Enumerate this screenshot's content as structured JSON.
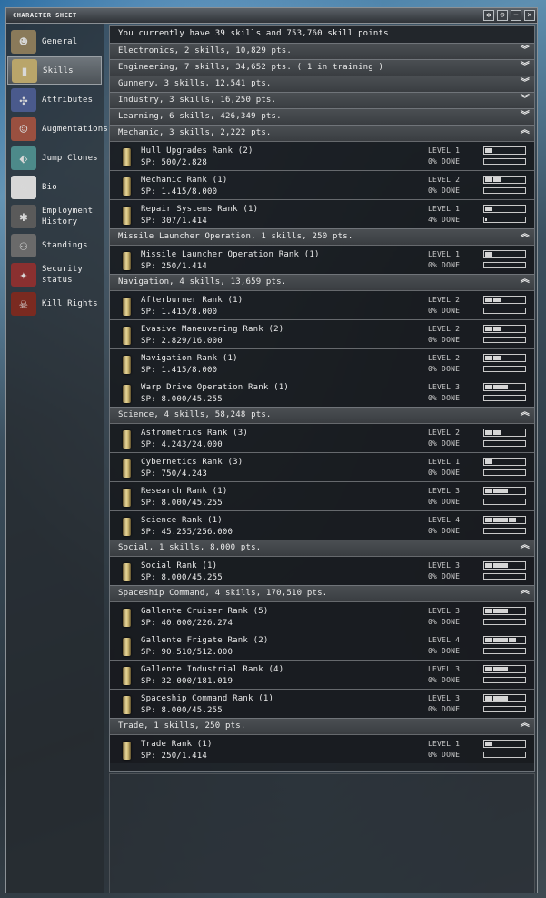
{
  "window": {
    "title": "CHARACTER SHEET"
  },
  "sidebar": [
    {
      "label": "General",
      "icon": "portrait-icon"
    },
    {
      "label": "Skills",
      "icon": "skillbook-icon"
    },
    {
      "label": "Attributes",
      "icon": "dna-icon"
    },
    {
      "label": "Augmentations",
      "icon": "augmentation-icon"
    },
    {
      "label": "Jump Clones",
      "icon": "jump-clone-icon"
    },
    {
      "label": "Bio",
      "icon": "bio-icon"
    },
    {
      "label": "Employment History",
      "icon": "employment-icon"
    },
    {
      "label": "Standings",
      "icon": "standings-icon"
    },
    {
      "label": "Security status",
      "icon": "security-icon"
    },
    {
      "label": "Kill Rights",
      "icon": "kill-rights-icon"
    }
  ],
  "summary": "You currently have 39 skills and 753,760 skill points",
  "groups": [
    {
      "label": "Electronics, 2 skills, 10,829 pts.",
      "expanded": false,
      "skills": []
    },
    {
      "label": "Engineering, 7 skills, 34,652 pts. ( 1 in training )",
      "expanded": false,
      "skills": []
    },
    {
      "label": "Gunnery, 3 skills, 12,541 pts.",
      "expanded": false,
      "skills": []
    },
    {
      "label": "Industry, 3 skills, 16,250 pts.",
      "expanded": false,
      "skills": []
    },
    {
      "label": "Learning, 6 skills, 426,349 pts.",
      "expanded": false,
      "skills": []
    },
    {
      "label": "Mechanic, 3 skills, 2,222 pts.",
      "expanded": true,
      "skills": [
        {
          "name": "Hull Upgrades Rank (2)",
          "sp": "SP:  500/2.828",
          "level": "LEVEL 1",
          "done": "0% DONE",
          "lvl": 1,
          "pct": 0
        },
        {
          "name": "Mechanic Rank (1)",
          "sp": "SP:  1.415/8.000",
          "level": "LEVEL 2",
          "done": "0% DONE",
          "lvl": 2,
          "pct": 0
        },
        {
          "name": "Repair Systems Rank (1)",
          "sp": "SP:  307/1.414",
          "level": "LEVEL 1",
          "done": "4% DONE",
          "lvl": 1,
          "pct": 4
        }
      ]
    },
    {
      "label": "Missile Launcher Operation, 1 skills, 250 pts.",
      "expanded": true,
      "skills": [
        {
          "name": "Missile Launcher Operation Rank (1)",
          "sp": "SP:  250/1.414",
          "level": "LEVEL 1",
          "done": "0% DONE",
          "lvl": 1,
          "pct": 0
        }
      ]
    },
    {
      "label": "Navigation, 4 skills, 13,659 pts.",
      "expanded": true,
      "skills": [
        {
          "name": "Afterburner Rank (1)",
          "sp": "SP:  1.415/8.000",
          "level": "LEVEL 2",
          "done": "0% DONE",
          "lvl": 2,
          "pct": 0
        },
        {
          "name": "Evasive Maneuvering Rank (2)",
          "sp": "SP:  2.829/16.000",
          "level": "LEVEL 2",
          "done": "0% DONE",
          "lvl": 2,
          "pct": 0
        },
        {
          "name": "Navigation Rank (1)",
          "sp": "SP:  1.415/8.000",
          "level": "LEVEL 2",
          "done": "0% DONE",
          "lvl": 2,
          "pct": 0
        },
        {
          "name": "Warp Drive Operation Rank (1)",
          "sp": "SP:  8.000/45.255",
          "level": "LEVEL 3",
          "done": "0% DONE",
          "lvl": 3,
          "pct": 0
        }
      ]
    },
    {
      "label": "Science, 4 skills, 58,248 pts.",
      "expanded": true,
      "skills": [
        {
          "name": "Astrometrics Rank (3)",
          "sp": "SP:  4.243/24.000",
          "level": "LEVEL 2",
          "done": "0% DONE",
          "lvl": 2,
          "pct": 0
        },
        {
          "name": "Cybernetics Rank (3)",
          "sp": "SP:  750/4.243",
          "level": "LEVEL 1",
          "done": "0% DONE",
          "lvl": 1,
          "pct": 0
        },
        {
          "name": "Research Rank (1)",
          "sp": "SP:  8.000/45.255",
          "level": "LEVEL 3",
          "done": "0% DONE",
          "lvl": 3,
          "pct": 0
        },
        {
          "name": "Science Rank (1)",
          "sp": "SP:  45.255/256.000",
          "level": "LEVEL 4",
          "done": "0% DONE",
          "lvl": 4,
          "pct": 0
        }
      ]
    },
    {
      "label": "Social, 1 skills, 8,000 pts.",
      "expanded": true,
      "skills": [
        {
          "name": "Social Rank (1)",
          "sp": "SP:  8.000/45.255",
          "level": "LEVEL 3",
          "done": "0% DONE",
          "lvl": 3,
          "pct": 0
        }
      ]
    },
    {
      "label": "Spaceship Command, 4 skills, 170,510 pts.",
      "expanded": true,
      "skills": [
        {
          "name": "Gallente Cruiser Rank (5)",
          "sp": "SP:  40.000/226.274",
          "level": "LEVEL 3",
          "done": "0% DONE",
          "lvl": 3,
          "pct": 0
        },
        {
          "name": "Gallente Frigate Rank (2)",
          "sp": "SP:  90.510/512.000",
          "level": "LEVEL 4",
          "done": "0% DONE",
          "lvl": 4,
          "pct": 0
        },
        {
          "name": "Gallente Industrial Rank (4)",
          "sp": "SP:  32.000/181.019",
          "level": "LEVEL 3",
          "done": "0% DONE",
          "lvl": 3,
          "pct": 0
        },
        {
          "name": "Spaceship Command Rank (1)",
          "sp": "SP:  8.000/45.255",
          "level": "LEVEL 3",
          "done": "0% DONE",
          "lvl": 3,
          "pct": 0
        }
      ]
    },
    {
      "label": "Trade, 1 skills, 250 pts.",
      "expanded": true,
      "skills": [
        {
          "name": "Trade Rank (1)",
          "sp": "SP:  250/1.414",
          "level": "LEVEL 1",
          "done": "0% DONE",
          "lvl": 1,
          "pct": 0
        }
      ]
    }
  ]
}
